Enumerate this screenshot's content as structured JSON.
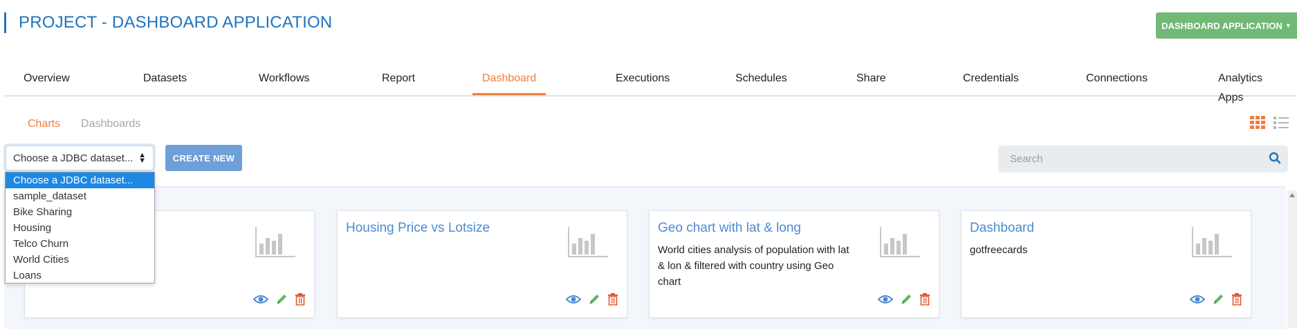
{
  "header": {
    "title": "PROJECT - DASHBOARD APPLICATION",
    "app_button": "DASHBOARD APPLICATION",
    "app_button_color": "#71b975"
  },
  "nav": {
    "tabs": [
      {
        "label": "Overview"
      },
      {
        "label": "Datasets"
      },
      {
        "label": "Workflows"
      },
      {
        "label": "Report"
      },
      {
        "label": "Dashboard",
        "active": true
      },
      {
        "label": "Executions"
      },
      {
        "label": "Schedules"
      },
      {
        "label": "Share"
      },
      {
        "label": "Credentials"
      },
      {
        "label": "Connections"
      },
      {
        "label": "Analytics Apps"
      }
    ],
    "active_color": "#ef7d3c"
  },
  "subtabs": {
    "charts": "Charts",
    "dashboards": "Dashboards"
  },
  "toolbar": {
    "select_value": "Choose a JDBC dataset...",
    "create_label": "CREATE NEW",
    "search_placeholder": "Search"
  },
  "dropdown": {
    "options": [
      "Choose a JDBC dataset...",
      "sample_dataset",
      "Bike Sharing",
      "Housing",
      "Telco Churn",
      "World Cities",
      "Loans"
    ],
    "selected_index": 0
  },
  "cards": [
    {
      "title": "",
      "description": ""
    },
    {
      "title": "Housing Price vs Lotsize",
      "description": ""
    },
    {
      "title": "Geo chart with lat & long",
      "description": "World cities analysis of population with lat & lon & filtered with country using Geo chart"
    },
    {
      "title": "Dashboard",
      "description": "gotfreecards"
    }
  ],
  "icons": {
    "view": "eye-icon",
    "edit": "pencil-icon",
    "delete": "trash-icon",
    "chart": "bar-chart-icon",
    "grid": "grid-view-icon",
    "list": "list-view-icon",
    "search": "search-icon"
  }
}
